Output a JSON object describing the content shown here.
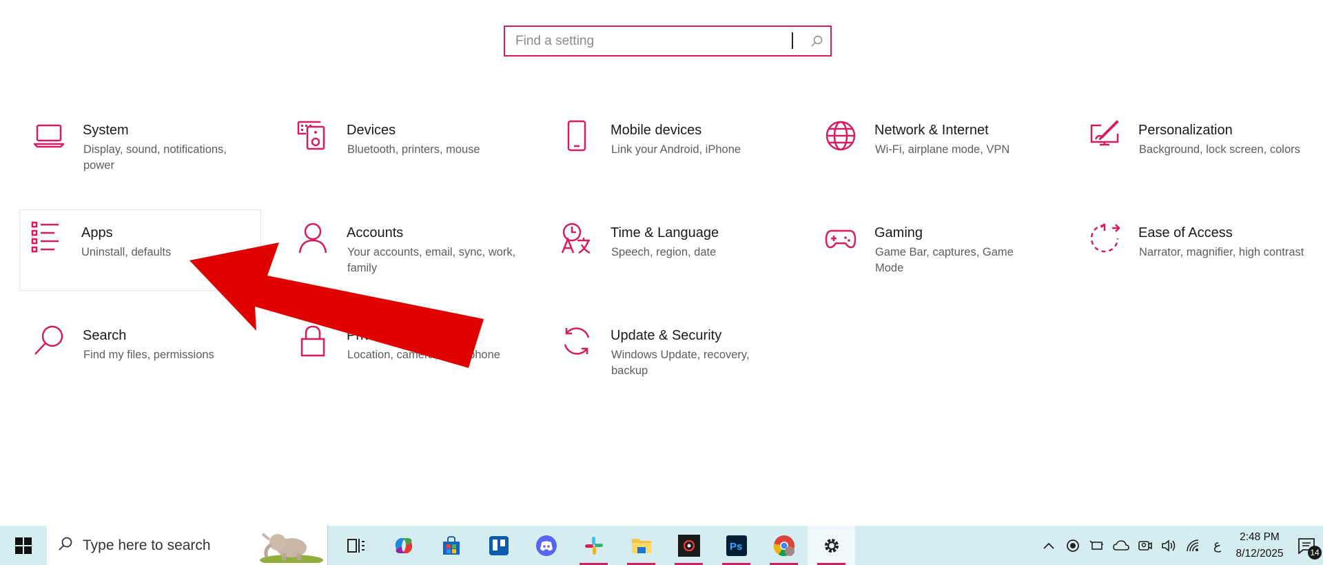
{
  "search": {
    "placeholder": "Find a setting"
  },
  "tiles": [
    {
      "title": "System",
      "desc": "Display, sound, notifications, power"
    },
    {
      "title": "Devices",
      "desc": "Bluetooth, printers, mouse"
    },
    {
      "title": "Mobile devices",
      "desc": "Link your Android, iPhone"
    },
    {
      "title": "Network & Internet",
      "desc": "Wi-Fi, airplane mode, VPN"
    },
    {
      "title": "Personalization",
      "desc": "Background, lock screen, colors"
    },
    {
      "title": "Apps",
      "desc": "Uninstall, defaults"
    },
    {
      "title": "Accounts",
      "desc": "Your accounts, email, sync, work, family"
    },
    {
      "title": "Time & Language",
      "desc": "Speech, region, date"
    },
    {
      "title": "Gaming",
      "desc": "Game Bar, captures, Game Mode"
    },
    {
      "title": "Ease of Access",
      "desc": "Narrator, magnifier, high contrast"
    },
    {
      "title": "Search",
      "desc": "Find my files, permissions"
    },
    {
      "title": "Privacy",
      "desc": "Location, camera, microphone"
    },
    {
      "title": "Update & Security",
      "desc": "Windows Update, recovery, backup"
    }
  ],
  "taskbar": {
    "search_placeholder": "Type here to search",
    "apps": [
      "task-view",
      "copilot",
      "microsoft-store",
      "trello",
      "discord",
      "slack",
      "file-explorer",
      "davinci-resolve",
      "photoshop",
      "chrome",
      "settings"
    ],
    "tray_extra_char": "ع",
    "time": "2:48 PM",
    "date": "8/12/2025",
    "notification_count": "14"
  },
  "colors": {
    "accent": "#d81b60",
    "arrow": "#e00000",
    "taskbar_bg": "#d5ecf0"
  }
}
